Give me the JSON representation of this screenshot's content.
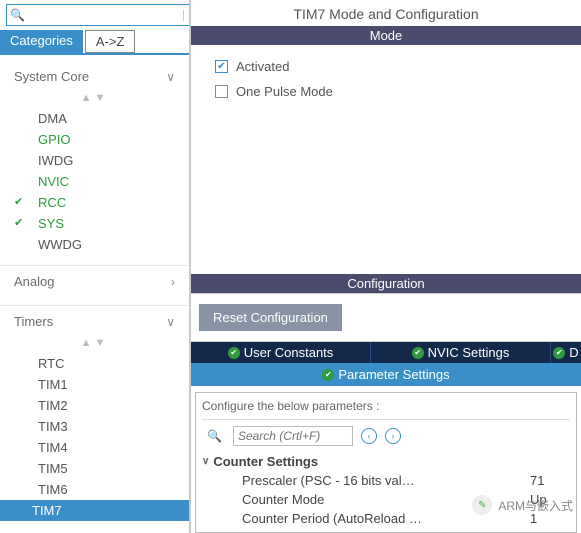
{
  "sidebar": {
    "search_value": "",
    "gear": "⚙",
    "tabs": {
      "categories": "Categories",
      "az": "A->Z"
    },
    "groups": {
      "system_core": {
        "label": "System Core",
        "items": [
          {
            "label": "DMA"
          },
          {
            "label": "GPIO"
          },
          {
            "label": "IWDG"
          },
          {
            "label": "NVIC"
          },
          {
            "label": "RCC"
          },
          {
            "label": "SYS"
          },
          {
            "label": "WWDG"
          }
        ]
      },
      "analog": {
        "label": "Analog"
      },
      "timers": {
        "label": "Timers",
        "items": [
          {
            "label": "RTC"
          },
          {
            "label": "TIM1"
          },
          {
            "label": "TIM2"
          },
          {
            "label": "TIM3"
          },
          {
            "label": "TIM4"
          },
          {
            "label": "TIM5"
          },
          {
            "label": "TIM6"
          },
          {
            "label": "TIM7"
          }
        ]
      }
    }
  },
  "main": {
    "title": "TIM7 Mode and Configuration",
    "mode": {
      "header": "Mode",
      "activated": "Activated",
      "one_pulse": "One Pulse Mode"
    },
    "config": {
      "header": "Configuration",
      "reset": "Reset Configuration",
      "tabs": {
        "user": "User Constants",
        "nvic": "NVIC Settings",
        "dma": "D",
        "param": "Parameter Settings"
      },
      "configure_label": "Configure the below parameters :",
      "search_placeholder": "Search (Crtl+F)",
      "group": "Counter Settings",
      "params": {
        "prescaler_k": "Prescaler (PSC - 16 bits val…",
        "prescaler_v": "71",
        "mode_k": "Counter Mode",
        "mode_v": "Up",
        "period_k": "Counter Period (AutoReload …",
        "period_v": "1"
      }
    }
  },
  "watermark": "ARM与嵌入式"
}
